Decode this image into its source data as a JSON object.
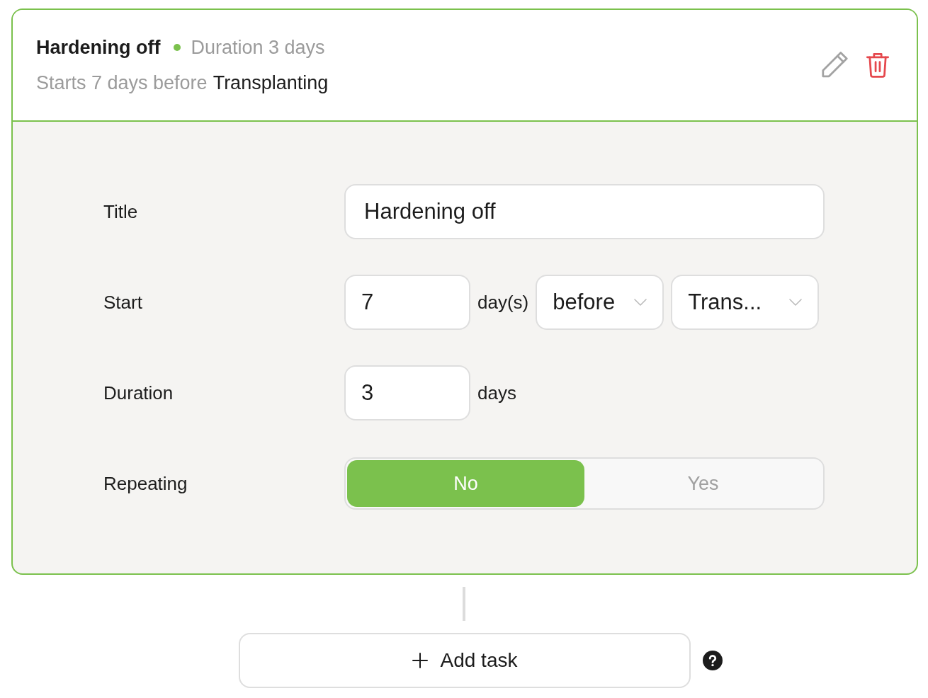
{
  "task": {
    "title": "Hardening off",
    "duration": "Duration 3 days",
    "start_text": "Starts 7 days before",
    "start_anchor": "Transplanting"
  },
  "form": [
    {
      "kind": "text",
      "label": "Title",
      "value": "Hardening off"
    },
    {
      "kind": "start",
      "label": "Start",
      "amount": "7",
      "unit": "day(s)",
      "relation": "before",
      "anchor": "Trans..."
    },
    {
      "kind": "number",
      "label": "Duration",
      "value": "3",
      "unit": "days"
    },
    {
      "kind": "toggle",
      "label": "Repeating",
      "options": [
        {
          "label": "No",
          "selected": true
        },
        {
          "label": "Yes",
          "selected": false
        }
      ]
    }
  ],
  "add_button": {
    "label": "Add task"
  }
}
